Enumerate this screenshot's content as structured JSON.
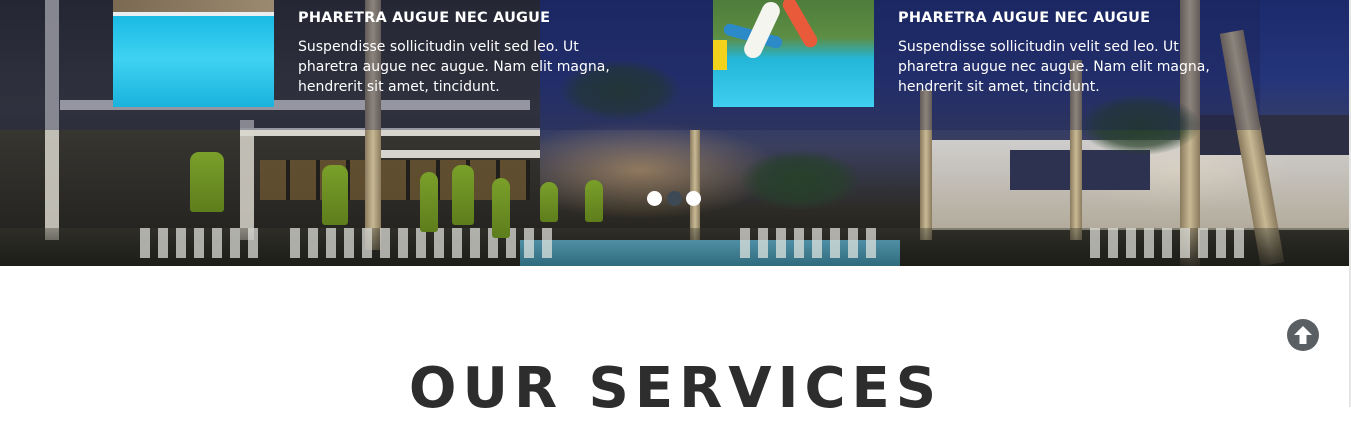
{
  "slider": {
    "items": [
      {
        "title": "PHARETRA AUGUE NEC AUGUE",
        "text": "Suspendisse sollicitudin velit sed leo. Ut pharetra augue nec augue. Nam elit magna, hendrerit sit amet, tincidunt.",
        "thumb": "pool-photo"
      },
      {
        "title": "PHARETRA AUGUE NEC AUGUE",
        "text": "Suspendisse sollicitudin velit sed leo. Ut pharetra augue nec augue. Nam elit magna, hendrerit sit amet, tincidunt.",
        "thumb": "waterslide-photo"
      }
    ],
    "pager": {
      "count": 3,
      "active_index": 1
    }
  },
  "back_to_top": {
    "icon": "arrow-up-circle-icon"
  },
  "services": {
    "title": "OUR SERVICES"
  },
  "colors": {
    "title": "#2d2d2d",
    "slide_text": "#ffffff",
    "dot": "#ffffff",
    "dot_active": "#3d4a55",
    "to_top": "#5a5f63"
  }
}
